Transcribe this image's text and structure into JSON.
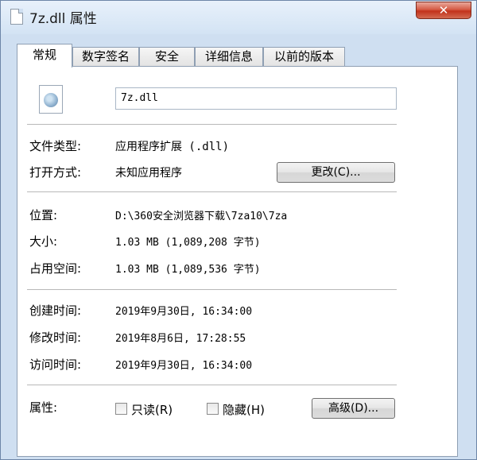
{
  "window": {
    "title": "7z.dll 属性",
    "close_label": "✕"
  },
  "tabs": [
    {
      "label": "常规",
      "active": true
    },
    {
      "label": "数字签名"
    },
    {
      "label": "安全"
    },
    {
      "label": "详细信息"
    },
    {
      "label": "以前的版本"
    }
  ],
  "general": {
    "file_name": "7z.dll",
    "file_type_label": "文件类型:",
    "file_type_value": "应用程序扩展 (.dll)",
    "open_with_label": "打开方式:",
    "open_with_value": "未知应用程序",
    "change_button": "更改(C)...",
    "location_label": "位置:",
    "location_value": "D:\\360安全浏览器下载\\7za10\\7za",
    "size_label": "大小:",
    "size_value": "1.03 MB (1,089,208 字节)",
    "size_on_disk_label": "占用空间:",
    "size_on_disk_value": "1.03 MB (1,089,536 字节)",
    "created_label": "创建时间:",
    "created_value": "2019年9月30日, 16:34:00",
    "modified_label": "修改时间:",
    "modified_value": "2019年8月6日, 17:28:55",
    "accessed_label": "访问时间:",
    "accessed_value": "2019年9月30日, 16:34:00",
    "attributes_label": "属性:",
    "readonly_label": "只读(R)",
    "hidden_label": "隐藏(H)",
    "advanced_button": "高级(D)..."
  }
}
